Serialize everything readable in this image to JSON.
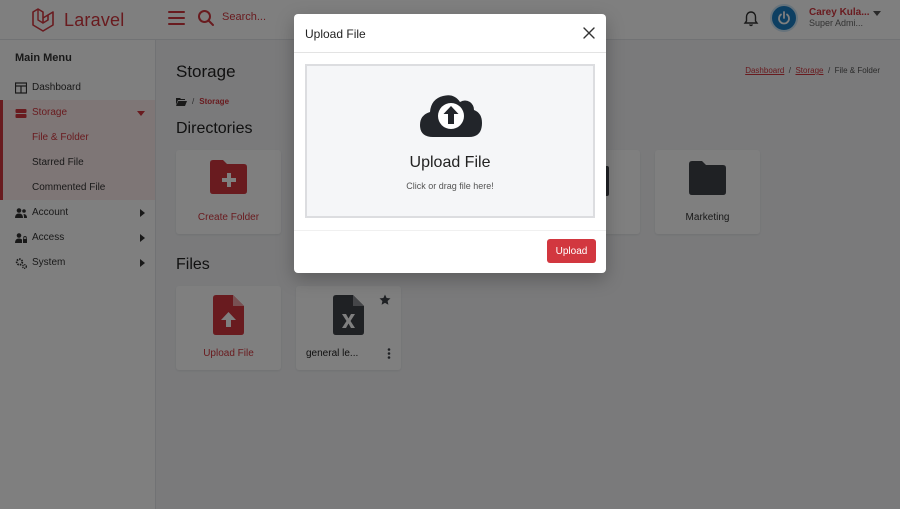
{
  "brand": {
    "name": "Laravel"
  },
  "header": {
    "search_placeholder": "Search...",
    "user_name": "Carey Kula...",
    "user_role": "Super Admi..."
  },
  "sidebar": {
    "title": "Main Menu",
    "items": [
      {
        "label": "Dashboard",
        "icon": "table-icon"
      },
      {
        "label": "Storage",
        "icon": "storage-icon"
      },
      {
        "label": "Account",
        "icon": "users-icon"
      },
      {
        "label": "Access",
        "icon": "user-lock-icon"
      },
      {
        "label": "System",
        "icon": "cogs-icon"
      }
    ],
    "storage_sub": [
      "File & Folder",
      "Starred File",
      "Commented File"
    ]
  },
  "main": {
    "title": "Storage",
    "breadcrumb": [
      "Dashboard",
      "Storage",
      "File & Folder"
    ],
    "path": "Storage",
    "directories_title": "Directories",
    "files_title": "Files",
    "directories": [
      {
        "label": "Create Folder"
      },
      {
        "label": "Marketing"
      }
    ],
    "files": [
      {
        "label": "Upload File"
      },
      {
        "label": "general le..."
      }
    ]
  },
  "modal": {
    "title": "Upload File",
    "drop_title": "Upload File",
    "drop_hint": "Click or drag file here!",
    "upload_label": "Upload"
  },
  "colors": {
    "accent": "#d2373f",
    "overlay": "rgba(0,0,0,0.5)"
  }
}
